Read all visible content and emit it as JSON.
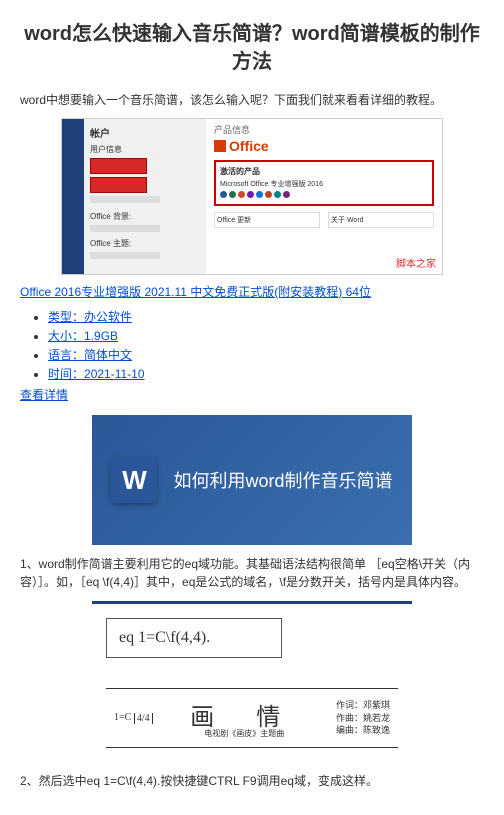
{
  "title": "word怎么快速输入音乐简谱？word简谱模板的制作方法",
  "intro": "word中想要输入一个音乐简谱，该怎么输入呢？下面我们就来看看详细的教程。",
  "shot1": {
    "sidebar_title": "帐户",
    "sidebar_sub1": "用户信息",
    "sidebar_sub2": "Office 背景:",
    "sidebar_sub3": "Office 主题:",
    "main_prodinfo": "产品信息",
    "office_brand": "Office",
    "activated_title": "激活的产品",
    "activated_line": "Microsoft Office 专业增强版 2016",
    "card1_title": "Office 更新",
    "card2_title": "关于 Word",
    "watermark": "脚本之家"
  },
  "download_link": "Office 2016专业增强版 2021.11 中文免费正式版(附安装教程) 64位",
  "meta": {
    "type_label": "类型：",
    "type_value": "办公软件",
    "size_label": "大小：",
    "size_value": "1.9GB",
    "lang_label": "语言：",
    "lang_value": "简体中文",
    "time_label": "时间：",
    "time_value": "2021-11-10"
  },
  "detail_link": "查看详情",
  "shot2_text": "如何利用word制作音乐简谱",
  "para1": "1、word制作简谱主要利用它的eq域功能。其基础语法结构很简单 ［eq空格\\开关（内容）］。如，［eq \\f(4,4)］其中，eq是公式的域名，\\f是分数开关，括号内是具体内容。",
  "shot3": {
    "eq_text": "eq 1=C\\f(4,4).",
    "key": "1=C",
    "time_sig": "4/4",
    "song_title": "画 情",
    "subtitle": "电视剧《画皮》主题曲",
    "composer1": "作词：邓紫琪",
    "composer2": "作曲：姚若龙",
    "composer3": "编曲：陈致逸"
  },
  "para2": "2、然后选中eq 1=C\\f(4,4).按快捷键CTRL F9调用eq域，变成这样。"
}
